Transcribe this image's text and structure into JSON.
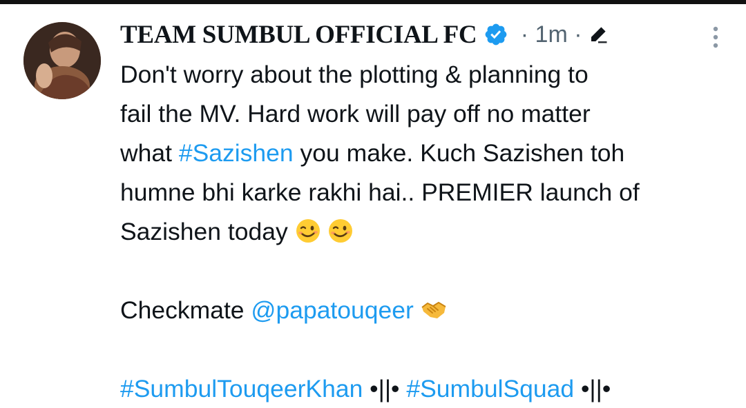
{
  "tweet": {
    "author": "TEAM SUMBUL OFFICIAL FC",
    "separator1": "·",
    "time": "1m",
    "separator2": "·",
    "verified": true,
    "icons": {
      "verified": "verified-badge-icon",
      "edit": "edit-pencil-icon",
      "more": "more-vertical-icon",
      "wink": "winking-face-emoji",
      "handshake": "handshake-emoji"
    },
    "colors": {
      "link": "#1d9bf0",
      "text": "#0f1419",
      "meta": "#536471"
    },
    "body": {
      "line1": "Don't worry about the plotting & planning to",
      "line2": "fail the MV. Hard work will pay off no matter",
      "line3_pre": "what ",
      "hashtag_sazishen": "#Sazishen",
      "line3_post": " you make. Kuch Sazishen toh",
      "line4": "humne bhi karke rakhi hai.. PREMIER launch of",
      "line5": "Sazishen today ",
      "checkmate_text": "Checkmate ",
      "mention": "@papatouqeer",
      "hashtag_stk": "#SumbulTouqeerKhan",
      "divider1": " •||• ",
      "hashtag_squad": "#SumbulSquad",
      "divider2": " •||•"
    }
  }
}
